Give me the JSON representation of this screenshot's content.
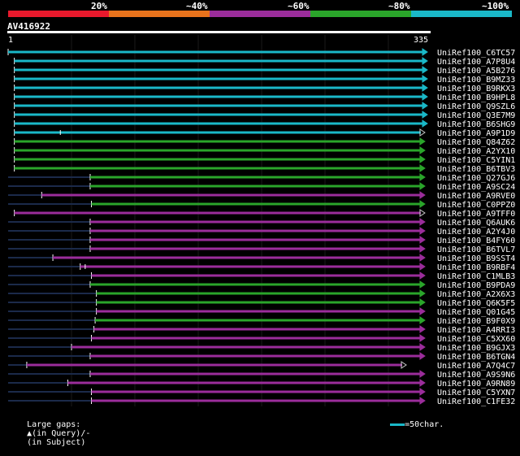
{
  "scale": {
    "labels": [
      "20%",
      "~40%",
      "~60%",
      "~80%",
      "~100%"
    ],
    "colors": [
      "#e8192c",
      "#e8731c",
      "#9b2d9b",
      "#2aa52a",
      "#1ab8c8"
    ]
  },
  "query": {
    "name": "AV416922",
    "start": "1",
    "end": "335",
    "length": 335
  },
  "hits": [
    {
      "id": "UniRef100_C6TC57",
      "color": "#1ab8c8",
      "s": 1,
      "e": 335,
      "arrow": true
    },
    {
      "id": "UniRef100_A7P8U4",
      "color": "#1ab8c8",
      "s": 6,
      "e": 335,
      "arrow": true
    },
    {
      "id": "UniRef100_A5B276",
      "color": "#1ab8c8",
      "s": 6,
      "e": 335,
      "arrow": true
    },
    {
      "id": "UniRef100_B9MZ33",
      "color": "#1ab8c8",
      "s": 6,
      "e": 335,
      "arrow": true
    },
    {
      "id": "UniRef100_B9RKX3",
      "color": "#1ab8c8",
      "s": 6,
      "e": 335,
      "arrow": true
    },
    {
      "id": "UniRef100_B9HPL8",
      "color": "#1ab8c8",
      "s": 6,
      "e": 335,
      "arrow": true
    },
    {
      "id": "UniRef100_Q9SZL6",
      "color": "#1ab8c8",
      "s": 6,
      "e": 335,
      "arrow": true
    },
    {
      "id": "UniRef100_Q3E7M9",
      "color": "#1ab8c8",
      "s": 6,
      "e": 335,
      "arrow": true
    },
    {
      "id": "UniRef100_B6SHG9",
      "color": "#1ab8c8",
      "s": 6,
      "e": 335,
      "arrow": true
    },
    {
      "id": "UniRef100_A9P1D9",
      "color": "#1ab8c8",
      "s": 6,
      "e": 333,
      "arrow": true,
      "openArrow": true,
      "gapq": 43
    },
    {
      "id": "UniRef100_Q84Z62",
      "color": "#2aa52a",
      "s": 6,
      "e": 333,
      "arrow": false
    },
    {
      "id": "UniRef100_A2YX10",
      "color": "#2aa52a",
      "s": 6,
      "e": 333,
      "arrow": false
    },
    {
      "id": "UniRef100_C5YIN1",
      "color": "#2aa52a",
      "s": 6,
      "e": 333,
      "arrow": false
    },
    {
      "id": "UniRef100_B6TBV3",
      "color": "#2aa52a",
      "s": 6,
      "e": 333,
      "arrow": false
    },
    {
      "id": "UniRef100_Q27GJ6",
      "color": "#2aa52a",
      "s": 67,
      "e": 333,
      "arrow": false,
      "dark": 0
    },
    {
      "id": "UniRef100_A9SC24",
      "color": "#2aa52a",
      "s": 67,
      "e": 333,
      "arrow": false,
      "dark": 0
    },
    {
      "id": "UniRef100_A9RVE0",
      "color": "#9b2d9b",
      "s": 28,
      "e": 333,
      "arrow": false,
      "dark": 0
    },
    {
      "id": "UniRef100_C0PPZ0",
      "color": "#2aa52a",
      "s": 68,
      "e": 333,
      "arrow": false,
      "dark": 0
    },
    {
      "id": "UniRef100_A9TFF0",
      "color": "#9b2d9b",
      "s": 6,
      "e": 333,
      "arrow": true,
      "openArrow": true
    },
    {
      "id": "UniRef100_Q6AUK6",
      "color": "#9b2d9b",
      "s": 67,
      "e": 333,
      "arrow": false,
      "dark": 0
    },
    {
      "id": "UniRef100_A2Y4J0",
      "color": "#9b2d9b",
      "s": 67,
      "e": 333,
      "arrow": false,
      "dark": 0
    },
    {
      "id": "UniRef100_B4FY60",
      "color": "#9b2d9b",
      "s": 67,
      "e": 333,
      "arrow": false,
      "dark": 0
    },
    {
      "id": "UniRef100_B6TVL7",
      "color": "#9b2d9b",
      "s": 67,
      "e": 333,
      "arrow": false,
      "dark": 0
    },
    {
      "id": "UniRef100_B9SST4",
      "color": "#9b2d9b",
      "s": 37,
      "e": 333,
      "arrow": false,
      "dark": 0
    },
    {
      "id": "UniRef100_B9RBF4",
      "color": "#9b2d9b",
      "s": 59,
      "e": 333,
      "arrow": false,
      "dark": 0,
      "gapq": 63
    },
    {
      "id": "UniRef100_C1MLB3",
      "color": "#9b2d9b",
      "s": 68,
      "e": 333,
      "arrow": false,
      "dark": 0
    },
    {
      "id": "UniRef100_B9PDA9",
      "color": "#2aa52a",
      "s": 67,
      "e": 333,
      "arrow": false,
      "dark": 0
    },
    {
      "id": "UniRef100_A2X6X3",
      "color": "#2aa52a",
      "s": 72,
      "e": 333,
      "arrow": false,
      "dark": 0
    },
    {
      "id": "UniRef100_Q6K5F5",
      "color": "#2aa52a",
      "s": 72,
      "e": 333,
      "arrow": false,
      "dark": 0
    },
    {
      "id": "UniRef100_Q01G45",
      "color": "#9b2d9b",
      "s": 72,
      "e": 333,
      "arrow": false,
      "dark": 0
    },
    {
      "id": "UniRef100_B9F0X9",
      "color": "#2aa52a",
      "s": 71,
      "e": 333,
      "arrow": false,
      "dark": 0
    },
    {
      "id": "UniRef100_A4RRI3",
      "color": "#9b2d9b",
      "s": 70,
      "e": 333,
      "arrow": false,
      "dark": 0
    },
    {
      "id": "UniRef100_C5XX60",
      "color": "#9b2d9b",
      "s": 68,
      "e": 333,
      "arrow": false,
      "dark": 0
    },
    {
      "id": "UniRef100_B9GJX3",
      "color": "#9b2d9b",
      "s": 52,
      "e": 333,
      "arrow": false,
      "dark": 0
    },
    {
      "id": "UniRef100_B6TGN4",
      "color": "#9b2d9b",
      "s": 67,
      "e": 333,
      "arrow": false,
      "dark": 0
    },
    {
      "id": "UniRef100_A7Q4C7",
      "color": "#9b2d9b",
      "s": 16,
      "e": 318,
      "arrow": true,
      "openArrow": true
    },
    {
      "id": "UniRef100_A9S9N6",
      "color": "#9b2d9b",
      "s": 67,
      "e": 333,
      "arrow": false,
      "dark": 0
    },
    {
      "id": "UniRef100_A9RN89",
      "color": "#9b2d9b",
      "s": 49,
      "e": 333,
      "arrow": false,
      "dark": 0
    },
    {
      "id": "UniRef100_C5YXN7",
      "color": "#9b2d9b",
      "s": 68,
      "e": 333,
      "arrow": false,
      "dark": 0
    },
    {
      "id": "UniRef100_C1FE32",
      "color": "#9b2d9b",
      "s": 68,
      "e": 333,
      "arrow": false,
      "dark": 0
    }
  ],
  "footer": {
    "legend_prefix": "Large gaps:",
    "in_query": "(in Query)/",
    "dash": "-",
    "in_subject": "(in Subject)",
    "scale_label": "=50char."
  }
}
